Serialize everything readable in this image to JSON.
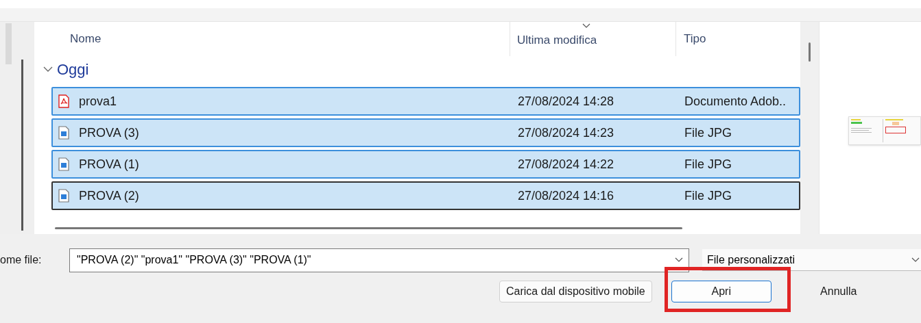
{
  "table": {
    "columns": [
      "Nome",
      "Ultima modifica",
      "Tipo"
    ],
    "groups": [
      {
        "label": "Oggi",
        "expanded": true,
        "rows": [
          {
            "name": "prova1",
            "kind": "pdf",
            "modified": "27/08/2024 14:28",
            "type": "Documento Adob..",
            "selected": true,
            "focused": false
          },
          {
            "name": "PROVA (3)",
            "kind": "image",
            "modified": "27/08/2024 14:23",
            "type": "File JPG",
            "selected": true,
            "focused": false
          },
          {
            "name": "PROVA (1)",
            "kind": "image",
            "modified": "27/08/2024 14:22",
            "type": "File JPG",
            "selected": true,
            "focused": false
          },
          {
            "name": "PROVA (2)",
            "kind": "image",
            "modified": "27/08/2024 14:16",
            "type": "File JPG",
            "selected": true,
            "focused": true
          }
        ]
      }
    ]
  },
  "file_name": {
    "label": "ome file:",
    "value": "\"PROVA (2)\" \"prova1\" \"PROVA (3)\" \"PROVA (1)\""
  },
  "file_type": {
    "value": "File personalizzati"
  },
  "buttons": [
    {
      "label": "Carica dal dispositivo mobile",
      "kind": "secondary",
      "highlighted": false
    },
    {
      "label": "Apri",
      "kind": "primary",
      "highlighted": true
    },
    {
      "label": "Annulla",
      "kind": "secondary",
      "highlighted": false
    }
  ]
}
